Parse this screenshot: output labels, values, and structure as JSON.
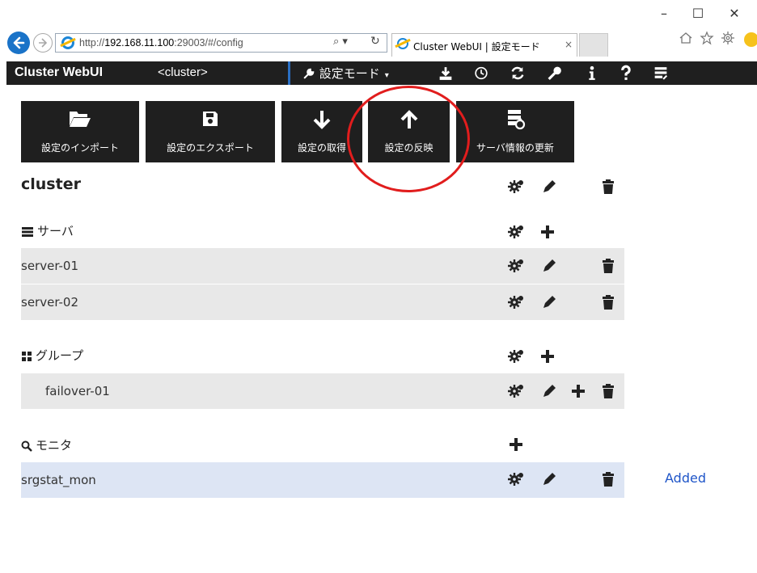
{
  "browser": {
    "url_prefix": "http://",
    "url_host": "192.168.11.100",
    "url_rest": ":29003/#/config",
    "tab_title": "Cluster WebUI | 設定モード",
    "tab_close": "×",
    "search_glyph": "⌕ ▾",
    "refresh_glyph": "↻",
    "window_controls": {
      "minimize": "–",
      "maximize": "☐",
      "close": "✕"
    },
    "toolbar_icons": [
      "home-icon",
      "favorites-star-icon",
      "settings-gear-icon",
      "smiley-feedback-icon"
    ]
  },
  "navbar": {
    "brand": "Cluster WebUI",
    "cluster": "<cluster>",
    "mode_label": "設定モード",
    "mode_caret": "▾",
    "icons": [
      "download-icon",
      "clock-icon",
      "refresh-icon",
      "key-icon",
      "info-icon",
      "help-icon",
      "server-list-icon"
    ]
  },
  "toolbar": {
    "buttons": [
      {
        "label": "設定のインポート",
        "icon": "folder-open-icon"
      },
      {
        "label": "設定のエクスポート",
        "icon": "save-icon"
      },
      {
        "label": "設定の取得",
        "icon": "arrow-down-icon"
      },
      {
        "label": "設定の反映",
        "icon": "arrow-up-icon"
      },
      {
        "label": "サーバ情報の更新",
        "icon": "server-refresh-icon"
      }
    ]
  },
  "tree": {
    "cluster_name": "cluster",
    "servers_heading": "サーバ",
    "servers": [
      {
        "name": "server-01"
      },
      {
        "name": "server-02"
      }
    ],
    "groups_heading": "グループ",
    "groups": [
      {
        "name": "failover-01"
      }
    ],
    "monitors_heading": "モニタ",
    "monitors": [
      {
        "name": "srgstat_mon",
        "status": "Added"
      }
    ]
  },
  "colors": {
    "dark_bar": "#1f1f1f",
    "accent_blue": "#2a6fc4",
    "added_text": "#1f55c8",
    "added_row": "#dde5f4",
    "row_bg": "#e8e8e8",
    "annotation_ring": "#e11d1d"
  }
}
